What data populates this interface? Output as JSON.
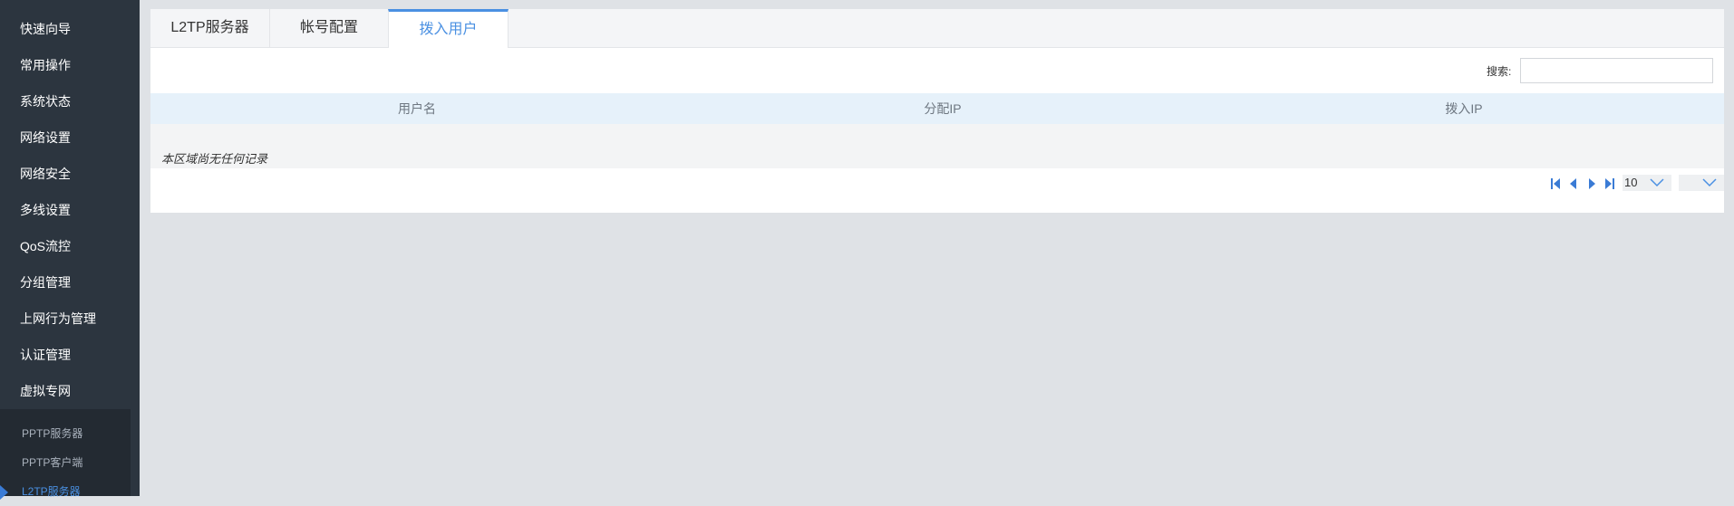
{
  "sidebar": {
    "items": [
      {
        "label": "快速向导"
      },
      {
        "label": "常用操作"
      },
      {
        "label": "系统状态"
      },
      {
        "label": "网络设置"
      },
      {
        "label": "网络安全"
      },
      {
        "label": "多线设置"
      },
      {
        "label": "QoS流控"
      },
      {
        "label": "分组管理"
      },
      {
        "label": "上网行为管理"
      },
      {
        "label": "认证管理"
      },
      {
        "label": "虚拟专网"
      }
    ],
    "submenu": [
      {
        "label": "PPTP服务器"
      },
      {
        "label": "PPTP客户端"
      },
      {
        "label": "L2TP服务器",
        "active": true
      }
    ]
  },
  "tabs": [
    {
      "label": "L2TP服务器"
    },
    {
      "label": "帐号配置"
    },
    {
      "label": "拨入用户",
      "active": true
    }
  ],
  "search": {
    "label": "搜索:",
    "value": ""
  },
  "table": {
    "columns": [
      "用户名",
      "分配IP",
      "拨入IP"
    ],
    "empty_text": "本区域尚无任何记录"
  },
  "pagination": {
    "page_size": "10",
    "page_select": ""
  },
  "colors": {
    "accent": "#4a90e2",
    "sidebar_bg": "#2c353f",
    "table_header_bg": "#e6f1fa"
  }
}
